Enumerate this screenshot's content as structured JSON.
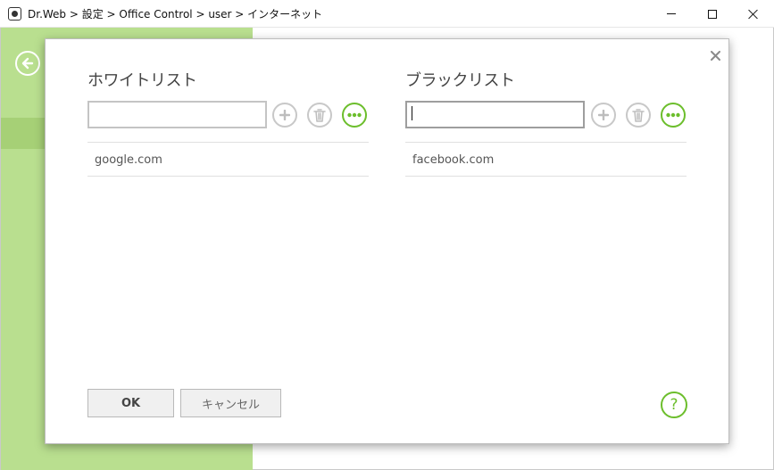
{
  "window": {
    "title": "Dr.Web > 設定 > Office Control > user > インターネット"
  },
  "dialog": {
    "whitelist": {
      "title": "ホワイトリスト",
      "input_value": "",
      "items": [
        "google.com"
      ]
    },
    "blacklist": {
      "title": "ブラックリスト",
      "input_value": "",
      "items": [
        "facebook.com"
      ]
    },
    "buttons": {
      "ok": "OK",
      "cancel": "キャンセル",
      "help": "?"
    }
  },
  "icons": {
    "app": "dr-web-logo-icon",
    "back": "back-arrow-icon",
    "close": "close-icon",
    "add": "plus-icon",
    "delete": "trash-icon",
    "more": "ellipsis-icon",
    "help": "question-icon"
  },
  "colors": {
    "accent_green": "#6cbe2c",
    "sidebar_green": "#b9df8f",
    "sidebar_band": "#a6d076"
  }
}
